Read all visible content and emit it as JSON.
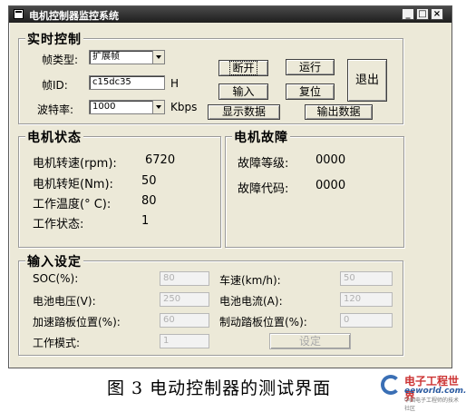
{
  "window": {
    "title": "电机控制器监控系统",
    "controls": [
      "_",
      "□",
      "×"
    ]
  },
  "realtime": {
    "title": "实时控制",
    "frame_type_label": "帧类型:",
    "frame_type_value": "扩展帧",
    "frame_id_label": "帧ID:",
    "frame_id_value": "c15dc35",
    "frame_id_suffix": "H",
    "baud_label": "波特率:",
    "baud_value": "1000",
    "baud_unit": "Kbps",
    "buttons": {
      "toggle": "断开",
      "run": "运行",
      "input": "输入",
      "reset": "复位",
      "exit": "退出",
      "show_data": "显示数据",
      "export_data": "输出数据"
    }
  },
  "motor_status": {
    "title": "电机状态",
    "speed_label": "电机转速(rpm):",
    "speed_value": "6720",
    "torque_label": "电机转矩(Nm):",
    "torque_value": "50",
    "temp_label": "工作温度(° C):",
    "temp_value": "80",
    "state_label": "工作状态:",
    "state_value": "1"
  },
  "motor_fault": {
    "title": "电机故障",
    "level_label": "故障等级:",
    "level_value": "0000",
    "code_label": "故障代码:",
    "code_value": "0000"
  },
  "input_settings": {
    "title": "输入设定",
    "soc_label": "SOC(%):",
    "soc_value": "80",
    "speed_label": "车速(km/h):",
    "speed_value": "50",
    "bat_volt_label": "电池电压(V):",
    "bat_volt_value": "250",
    "bat_curr_label": "电池电流(A):",
    "bat_curr_value": "120",
    "accel_label": "加速踏板位置(%):",
    "accel_value": "60",
    "brake_label": "制动踏板位置(%):",
    "brake_value": "0",
    "mode_label": "工作模式:",
    "mode_value": "1",
    "set_button": "设定"
  },
  "caption": "图 3  电动控制器的测试界面",
  "logo": {
    "line1": "电子工程世界",
    "line2": "eeworld.com.cn",
    "line3": "中国电子工程师的技术社区"
  }
}
